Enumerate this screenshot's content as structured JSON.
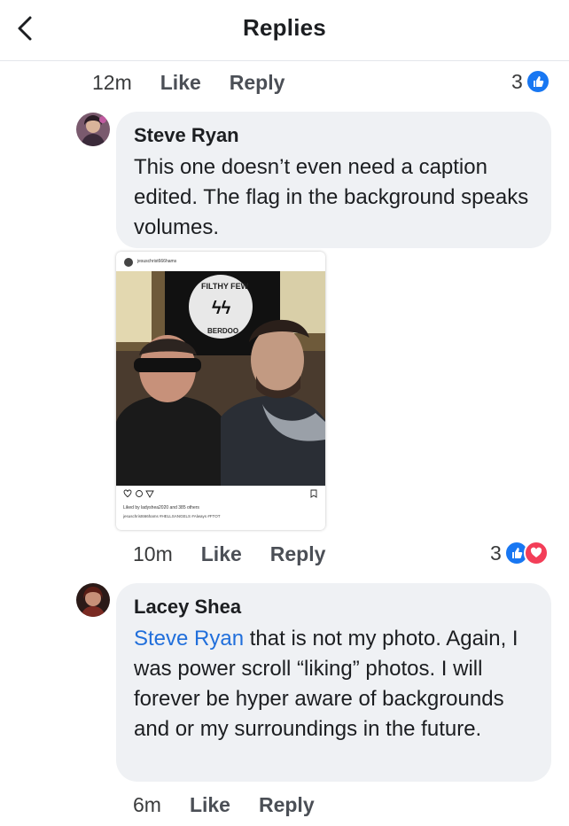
{
  "header": {
    "title": "Replies"
  },
  "top_meta": {
    "time": "12m",
    "like": "Like",
    "reply": "Reply",
    "reaction_count": "3"
  },
  "comments": [
    {
      "author": "Steve Ryan",
      "text": "This one doesn’t even need a caption edited. The flag in the background speaks volumes.",
      "time": "10m",
      "like": "Like",
      "reply": "Reply",
      "reaction_count": "3"
    },
    {
      "author": "Lacey Shea",
      "mention": "Steve Ryan",
      "text": " that is not my photo. Again, I was power scroll “liking” photos. I will forever be hyper aware of backgrounds and or my surroundings in the future.",
      "time": "6m",
      "like": "Like",
      "reply": "Reply"
    }
  ],
  "attached_post": {
    "username": "jesuschrist666hams",
    "liked_by": "Liked by ladyshea2020 and 385 others",
    "caption": "jesuschrist666hams #HELLSANGELS #Always #FTOT",
    "patch_text": "FILTHY FEW",
    "patch_bottom": "BERDOO"
  },
  "colors": {
    "like_blue": "#1877f2",
    "love_red": "#f33e58",
    "bubble_bg": "#eff1f4",
    "mention": "#216fdb"
  },
  "icons": [
    "back-chevron-icon",
    "like-reaction-icon",
    "love-reaction-icon"
  ]
}
